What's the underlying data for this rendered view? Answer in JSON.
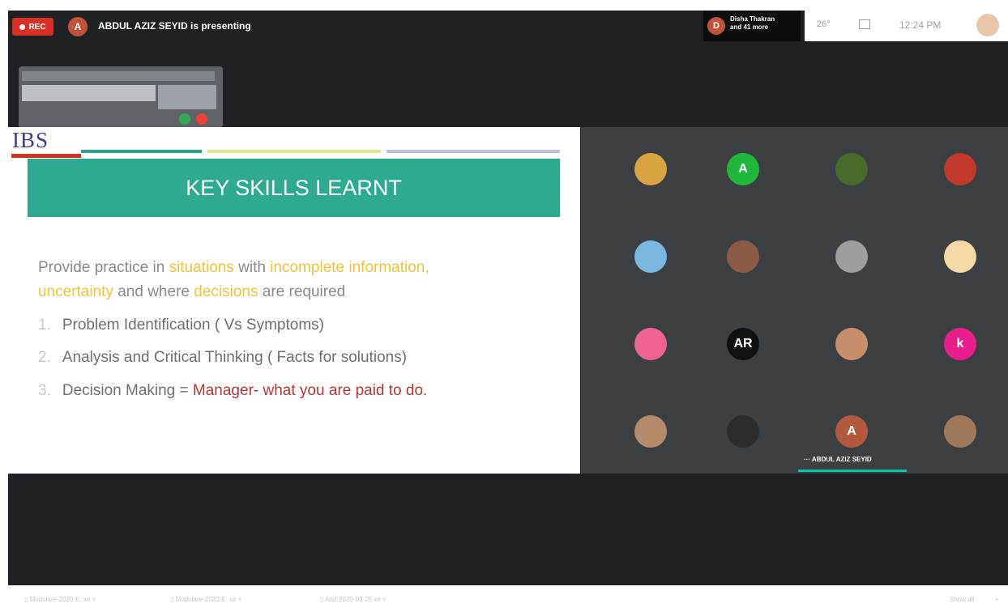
{
  "recording": {
    "label": "REC"
  },
  "presenter": {
    "initial": "A",
    "text": "ABDUL AZIZ SEYID is presenting"
  },
  "participants": {
    "initial": "D",
    "line1": "Disha Thakran",
    "line2": "and 41 more"
  },
  "status_bar": {
    "temperature": "26°",
    "time": "12:24 PM"
  },
  "slide": {
    "logo": "IBS",
    "title": "KEY SKILLS LEARNT",
    "intro": {
      "t1": "Provide practice in ",
      "h1": "situations",
      "t2": " with ",
      "h2": "incomplete information,",
      "h3": "uncertainty",
      "t3": " and where ",
      "h4": "decisions",
      "t4": " are required"
    },
    "items": [
      {
        "num": "1.",
        "text": "Problem Identification ( Vs Symptoms)"
      },
      {
        "num": "2.",
        "text": "Analysis and Critical Thinking ( Facts for solutions)"
      },
      {
        "num": "3.",
        "text": "Decision Making = ",
        "highlight": "Manager- what you are paid to do."
      }
    ]
  },
  "tiles": [
    {
      "initial": "",
      "color": "#d9a441"
    },
    {
      "initial": "A",
      "color": "#1fb83b"
    },
    {
      "initial": "",
      "color": "#4a6a2a"
    },
    {
      "initial": "",
      "color": "#c0392b"
    },
    {
      "initial": "",
      "color": "#7ab8e0"
    },
    {
      "initial": "",
      "color": "#8a5a44"
    },
    {
      "initial": "",
      "color": "#9e9e9e"
    },
    {
      "initial": "",
      "color": "#f3d9a4"
    },
    {
      "initial": "",
      "color": "#f06292"
    },
    {
      "initial": "AR",
      "color": "#111111"
    },
    {
      "initial": "",
      "color": "#c98e6a"
    },
    {
      "initial": "k",
      "color": "#e91e8c"
    },
    {
      "initial": "",
      "color": "#b58b6c"
    },
    {
      "initial": "",
      "color": "#2c2c2c"
    },
    {
      "initial": "A",
      "color": "#b45a3c"
    },
    {
      "initial": "",
      "color": "#a0785a"
    }
  ],
  "active_speaker": {
    "name": "ABDUL AZIZ SEYID"
  },
  "downloads": [
    {
      "name": "Modulare-2020-E..xe"
    },
    {
      "name": "Modulare-2020-E..xe"
    },
    {
      "name": "Add-2020-09-25.xe"
    }
  ],
  "downloads_show_all": "Show all"
}
